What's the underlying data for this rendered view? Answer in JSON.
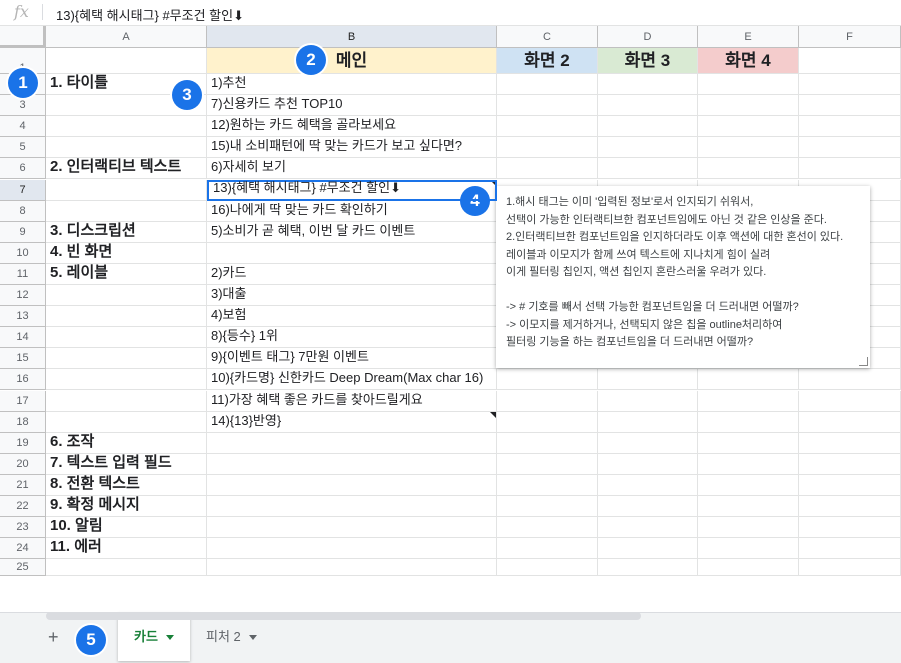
{
  "formula_bar": {
    "fx": "fx",
    "content": "13){혜택 해시태그} #무조건 할인⬇"
  },
  "columns": [
    "A",
    "B",
    "C",
    "D",
    "E",
    "F"
  ],
  "rows": [
    "1",
    "2",
    "3",
    "4",
    "5",
    "6",
    "7",
    "8",
    "9",
    "10",
    "11",
    "12",
    "13",
    "14",
    "15",
    "16",
    "17",
    "18",
    "19",
    "20",
    "21",
    "22",
    "23",
    "24",
    "25"
  ],
  "header_cells": {
    "b": "메인",
    "c": "화면 2",
    "d": "화면 3",
    "e": "화면 4"
  },
  "header_colors": {
    "b": "#fff2cc",
    "c": "#cfe2f3",
    "d": "#d9ead3",
    "e": "#f4cccc"
  },
  "col_a": {
    "2": "1. 타이틀",
    "6": "2. 인터랙티브 텍스트",
    "9": "3. 디스크립션",
    "10": "4. 빈 화면",
    "11": "5. 레이블",
    "19": "6. 조작",
    "20": "7. 텍스트 입력 필드",
    "21": "8. 전환 텍스트",
    "22": "9. 확정 메시지",
    "23": "10. 알림",
    "24": "11. 에러"
  },
  "col_b": {
    "2": "1)추천",
    "3": "7)신용카드 추천 TOP10",
    "4": "12)원하는 카드 혜택을 골라보세요",
    "5": "15)내 소비패턴에 딱 맞는 카드가 보고 싶다면?",
    "6": "6)자세히 보기",
    "7": "13){혜택 해시태그} #무조건 할인⬇",
    "8": "16)나에게 딱 맞는 카드 확인하기",
    "9": "5)소비가 곧 혜택, 이번 달 카드 이벤트",
    "11": "2)카드",
    "12": "3)대출",
    "13": "4)보험",
    "14": "8){등수} 1위",
    "15": "9){이벤트 태그} 7만원 이벤트",
    "16": "10){카드명} 신한카드 Deep Dream(Max char 16)",
    "17": "11)가장 혜택 좋은 카드를 찾아드릴게요",
    "18": "14){13}반영}"
  },
  "note_lines": [
    "1.해시 태그는 이미 '입력된 정보'로서 인지되기 쉬워서,",
    "선택이 가능한 인터랙티브한 컴포넌트임에도 아닌 것 같은 인상을 준다.",
    "2.인터랙티브한 컴포넌트임을 인지하더라도 이후 액션에 대한 혼선이 있다.",
    "레이블과 이모지가 함께 쓰여 텍스트에 지나치게 힘이 실려",
    "이게 필터링 칩인지, 액션 칩인지 혼란스러울 우려가 있다.",
    "",
    "-> # 기호를 빼서 선택 가능한 컴포넌트임을 더 드러내면 어떨까?",
    "-> 이모지를 제거하거나, 선택되지 않은 칩을 outline처리하여",
    "필터링 기능을 하는 컴포넌트임을 더 드러내면 어떨까?"
  ],
  "badges": [
    "1",
    "2",
    "3",
    "4",
    "5"
  ],
  "tabs": {
    "add": "+",
    "sheet1": "카드",
    "sheet2": "피처 2"
  },
  "colors": {
    "badge": "#1a73e8",
    "active_tab": "#188038",
    "selection": "#1a73e8"
  }
}
